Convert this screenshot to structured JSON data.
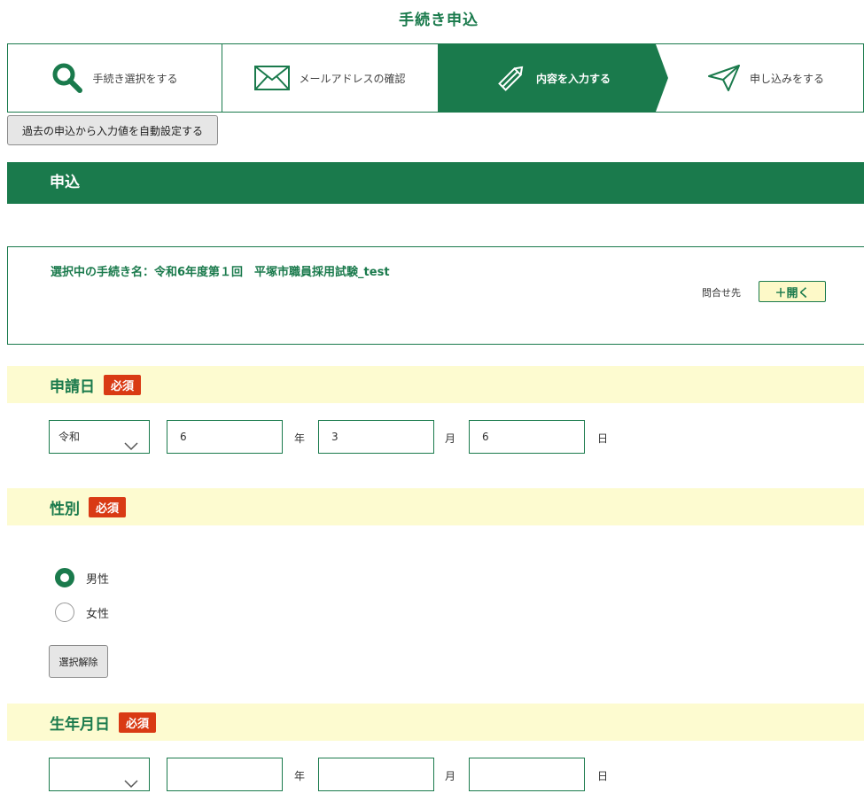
{
  "page": {
    "title": "手続き申込"
  },
  "steps": [
    {
      "label": "手続き選択をする",
      "icon": "search-icon",
      "active": false
    },
    {
      "label": "メールアドレスの確認",
      "icon": "mail-icon",
      "active": false
    },
    {
      "label": "内容を入力する",
      "icon": "pencil-icon",
      "active": true
    },
    {
      "label": "申し込みをする",
      "icon": "send-icon",
      "active": false
    }
  ],
  "autofill_button": "過去の申込から入力値を自動設定する",
  "section": {
    "title": "申込"
  },
  "info": {
    "procedure_name": "選択中の手続き名：令和6年度第１回　平塚市職員採用試験_test",
    "contact_label": "問合せ先",
    "open_button": "＋開く"
  },
  "application_date": {
    "label": "申請日",
    "required": "必須",
    "era": "令和",
    "year": "6",
    "year_unit": "年",
    "month": "3",
    "month_unit": "月",
    "day": "6",
    "day_unit": "日"
  },
  "gender": {
    "label": "性別",
    "required": "必須",
    "options": [
      {
        "label": "男性",
        "selected": true
      },
      {
        "label": "女性",
        "selected": false
      }
    ],
    "clear_button": "選択解除"
  },
  "birth_date": {
    "label": "生年月日",
    "required": "必須",
    "era": "",
    "year": "",
    "year_unit": "年",
    "month": "",
    "month_unit": "月",
    "day": "",
    "day_unit": "日"
  },
  "colors": {
    "primary": "#1a7a4c",
    "field_band": "#fdfbd0",
    "required": "#d93a14"
  }
}
